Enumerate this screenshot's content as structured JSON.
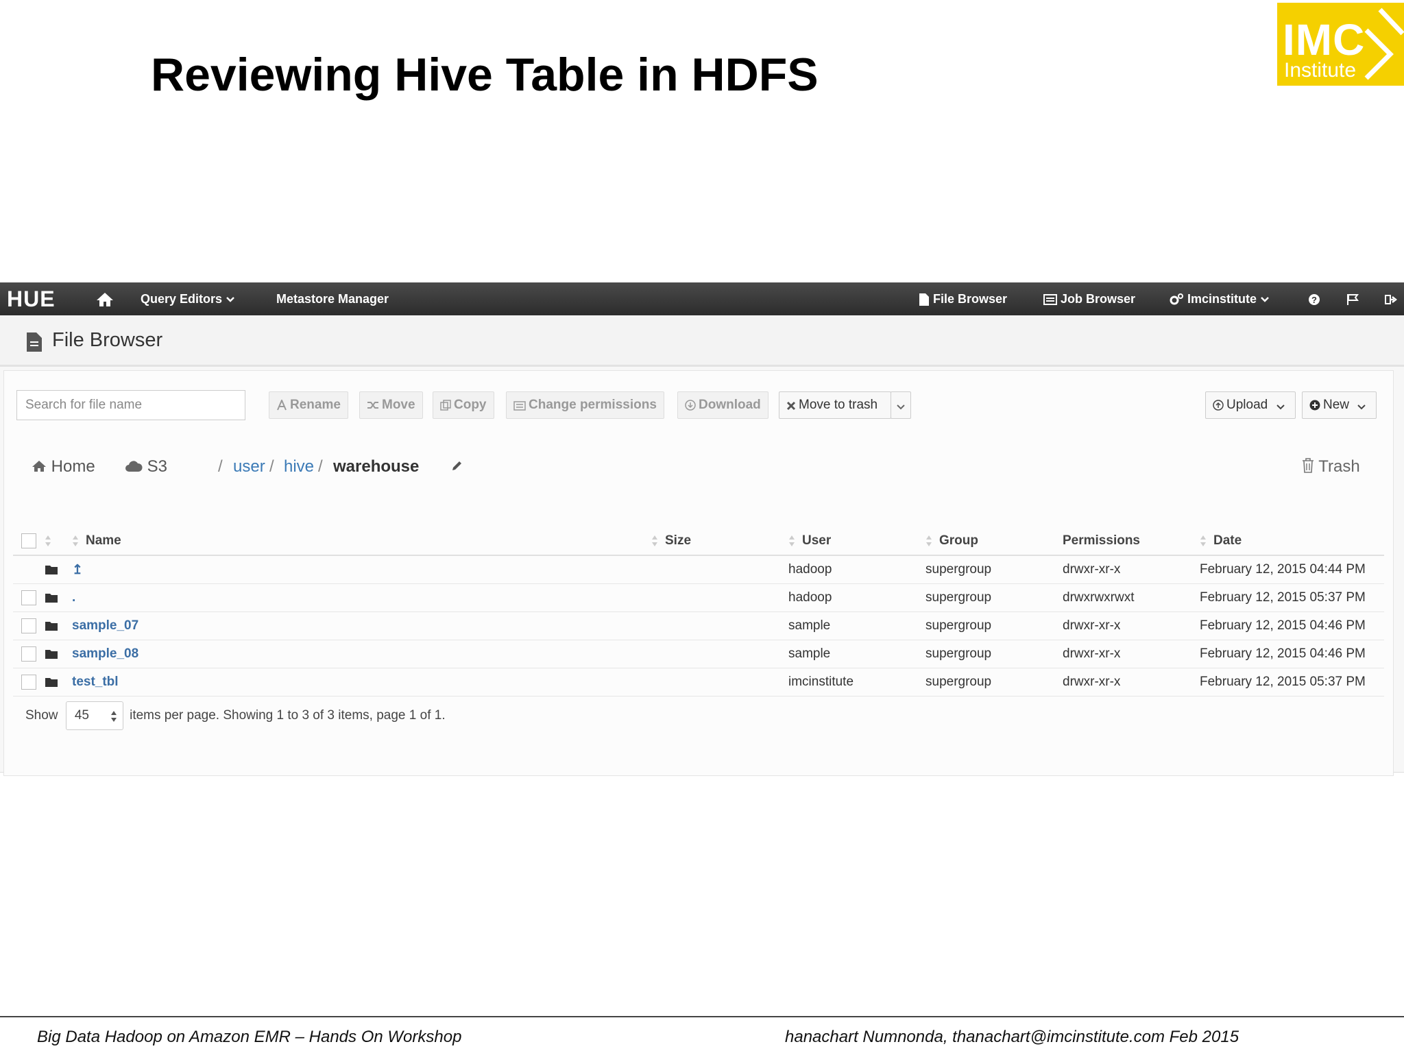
{
  "slide": {
    "title": "Reviewing Hive Table in HDFS",
    "logo": {
      "main": "IMC",
      "sub": "Institute",
      "color": "#f5d000"
    },
    "footer_left": "Big Data Hadoop on Amazon EMR – Hands On Workshop",
    "footer_right": "hanachart Numnonda,  thanachart@imcinstitute.com   Feb 2015"
  },
  "topnav": {
    "brand": "HUE",
    "home_icon": "home-icon",
    "query_editors": "Query Editors",
    "metastore": "Metastore Manager",
    "file_browser": "File Browser",
    "job_browser": "Job Browser",
    "user": "Imcinstitute",
    "help_icon": "help-icon",
    "flag_icon": "flag-icon",
    "logout_icon": "logout-icon"
  },
  "page": {
    "title": "File Browser"
  },
  "toolbar": {
    "search_placeholder": "Search for file name",
    "rename": "Rename",
    "move": "Move",
    "copy": "Copy",
    "change_permissions": "Change permissions",
    "download": "Download",
    "move_to_trash": "Move to trash",
    "upload": "Upload",
    "new": "New"
  },
  "breadcrumb": {
    "home": "Home",
    "s3": "S3",
    "root_sep": "/",
    "user": "user",
    "sep1": "/",
    "hive": "hive",
    "sep2": "/",
    "current": "warehouse",
    "trash": "Trash"
  },
  "table": {
    "columns": {
      "name": "Name",
      "size": "Size",
      "user": "User",
      "group": "Group",
      "permissions": "Permissions",
      "date": "Date"
    },
    "rows": [
      {
        "name": "↥",
        "size": "",
        "user": "hadoop",
        "group": "supergroup",
        "permissions": "drwxr-xr-x",
        "date": "February 12, 2015 04:44 PM",
        "checkbox": false
      },
      {
        "name": ".",
        "size": "",
        "user": "hadoop",
        "group": "supergroup",
        "permissions": "drwxrwxrwxt",
        "date": "February 12, 2015 05:37 PM",
        "checkbox": true
      },
      {
        "name": "sample_07",
        "size": "",
        "user": "sample",
        "group": "supergroup",
        "permissions": "drwxr-xr-x",
        "date": "February 12, 2015 04:46 PM",
        "checkbox": true
      },
      {
        "name": "sample_08",
        "size": "",
        "user": "sample",
        "group": "supergroup",
        "permissions": "drwxr-xr-x",
        "date": "February 12, 2015 04:46 PM",
        "checkbox": true
      },
      {
        "name": "test_tbl",
        "size": "",
        "user": "imcinstitute",
        "group": "supergroup",
        "permissions": "drwxr-xr-x",
        "date": "February 12, 2015 05:37 PM",
        "checkbox": true
      }
    ]
  },
  "paging": {
    "show": "Show",
    "per_page": "45",
    "text": "items per page. Showing 1 to 3 of 3 items, page 1 of 1."
  }
}
